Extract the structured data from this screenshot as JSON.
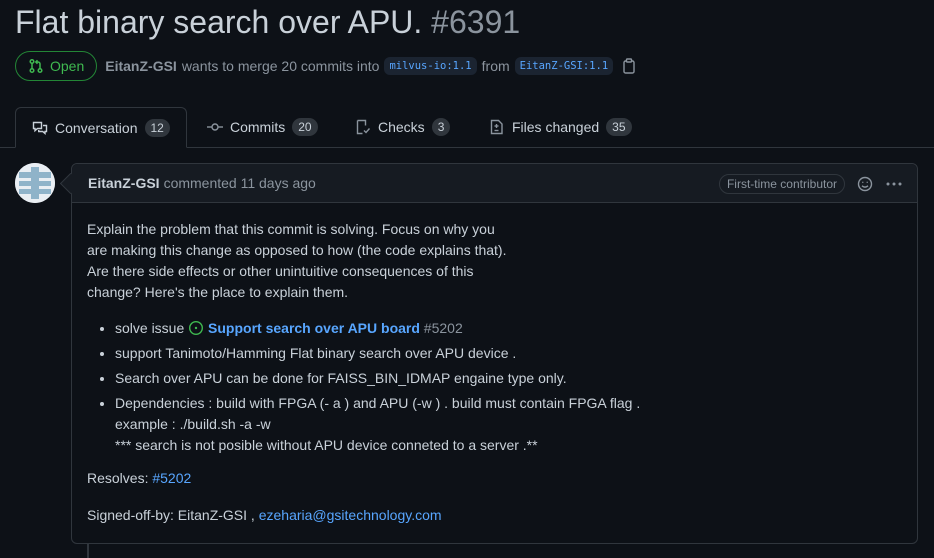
{
  "pr": {
    "title": "Flat binary search over APU.",
    "number": "#6391",
    "state": "Open",
    "author": "EitanZ-GSI",
    "merge_text": "wants to merge 20 commits into",
    "base_branch": "milvus-io:1.1",
    "from_text": "from",
    "head_branch": "EitanZ-GSI:1.1"
  },
  "tabs": [
    {
      "label": "Conversation",
      "count": "12",
      "icon": "comment-discussion-icon"
    },
    {
      "label": "Commits",
      "count": "20",
      "icon": "git-commit-icon"
    },
    {
      "label": "Checks",
      "count": "3",
      "icon": "checklist-icon"
    },
    {
      "label": "Files changed",
      "count": "35",
      "icon": "file-diff-icon"
    }
  ],
  "comment": {
    "author": "EitanZ-GSI",
    "action": "commented 11 days ago",
    "badge": "First-time contributor",
    "body_lines": [
      "Explain the problem that this commit is solving. Focus on why you",
      "are making this change as opposed to how (the code explains that).",
      "Are there side effects or other unintuitive consequences of this",
      "change? Here's the place to explain them."
    ],
    "bullets": {
      "b1_prefix": "solve issue",
      "b1_link": "Support search over APU board",
      "b1_issue": "#5202",
      "b2": "support Tanimoto/Hamming Flat binary search over APU device .",
      "b3": "Search over APU can be done for FAISS_BIN_IDMAP engaine type only.",
      "b4_line1": "Dependencies : build with FPGA (- a ) and APU (-w ) . build must contain FPGA flag .",
      "b4_line2": "example : ./build.sh -a -w",
      "b4_line3": "*** search is not posible without APU device conneted to a server .**"
    },
    "resolves_label": "Resolves:",
    "resolves_link": "#5202",
    "signed_off_label": "Signed-off-by: EitanZ-GSI ,",
    "signed_off_email": "ezeharia@gsitechnology.com"
  },
  "colors": {
    "background": "#0d1117",
    "open_green": "#3fb950",
    "link_blue": "#58a6ff"
  }
}
